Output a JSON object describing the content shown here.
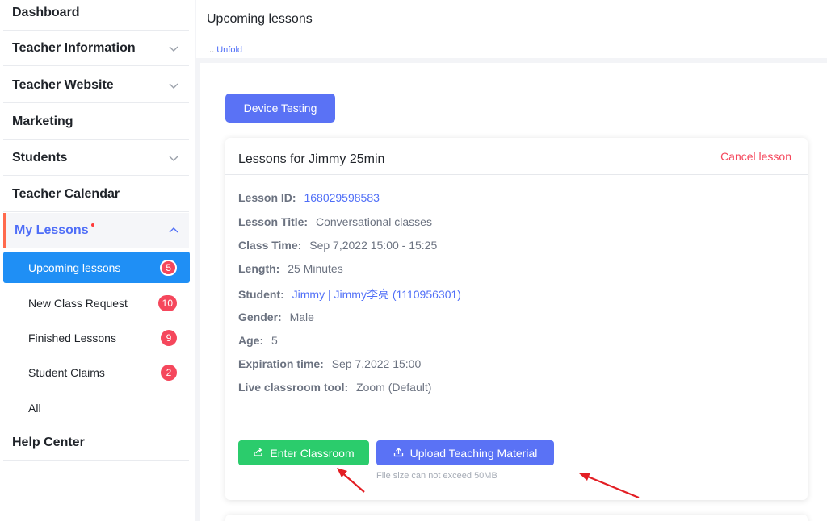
{
  "sidebar": {
    "items": [
      {
        "label": "Dashboard"
      },
      {
        "label": "Teacher Information"
      },
      {
        "label": "Teacher Website"
      },
      {
        "label": "Marketing"
      },
      {
        "label": "Students"
      },
      {
        "label": "Teacher Calendar"
      },
      {
        "label": "My Lessons"
      },
      {
        "label": "Help Center"
      }
    ],
    "sub_items": [
      {
        "label": "Upcoming lessons",
        "count": "5"
      },
      {
        "label": "New Class Request",
        "count": "10"
      },
      {
        "label": "Finished Lessons",
        "count": "9"
      },
      {
        "label": "Student Claims",
        "count": "2"
      },
      {
        "label": "All"
      }
    ]
  },
  "header": {
    "title": "Upcoming lessons",
    "ellipsis": "...",
    "unfold_label": "Unfold"
  },
  "device_testing_label": "Device Testing",
  "card": {
    "title": "Lessons for Jimmy 25min",
    "cancel_label": "Cancel lesson",
    "fields": [
      {
        "key": "Lesson ID:",
        "value": "168029598583"
      },
      {
        "key": "Lesson Title:",
        "value": "Conversational classes"
      },
      {
        "key": "Class Time:",
        "value": "Sep 7,2022 15:00 - 15:25"
      },
      {
        "key": "Length:",
        "value": "25 Minutes"
      },
      {
        "key": "Student:",
        "value": "Jimmy | Jimmy李亮 (1110956301)"
      },
      {
        "key": "Gender:",
        "value": "Male"
      },
      {
        "key": "Age:",
        "value": "5"
      },
      {
        "key": "Expiration time:",
        "value": "Sep 7,2022 15:00"
      },
      {
        "key": "Live classroom tool:",
        "value": "Zoom (Default)"
      }
    ],
    "enter_label": "Enter Classroom",
    "upload_label": "Upload Teaching Material",
    "upload_hint": "File size can not exceed 50MB"
  },
  "colors": {
    "accent": "#5a72f5",
    "selected_bg": "#1f8ff5",
    "badge": "#f5475c",
    "enter_green": "#2bcc6c",
    "cancel_red": "#f5475c",
    "annotation_arrow": "#e31e24"
  }
}
